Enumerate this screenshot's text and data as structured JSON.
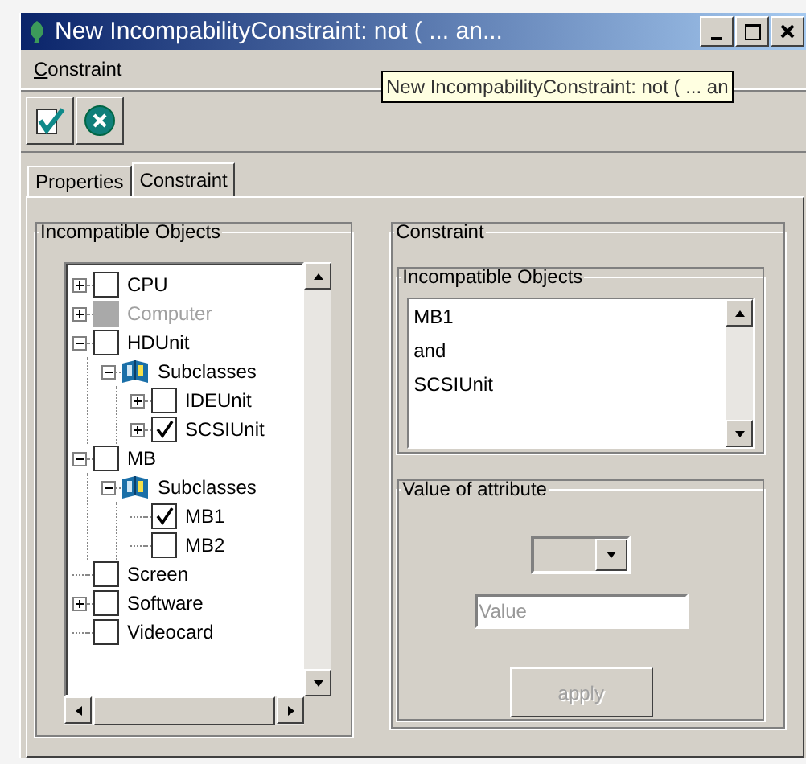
{
  "window": {
    "title": "New IncompabilityConstraint: not ( ... an..."
  },
  "menu": [
    {
      "label": "Constraint",
      "mnemonic_underlined": true
    }
  ],
  "tooltip": "New IncompabilityConstraint: not ( ... an",
  "toolbar": [
    {
      "kind": "ok"
    },
    {
      "kind": "cancel"
    }
  ],
  "tabs": [
    {
      "label": "Properties",
      "selected": false
    },
    {
      "label": "Constraint",
      "selected": true
    }
  ],
  "objects_group": {
    "title": "Incompatible Objects",
    "tree": [
      {
        "label": "CPU",
        "kind": "checkbox",
        "expandable": true,
        "expanded": false,
        "checked": false,
        "disabled": false
      },
      {
        "label": "Computer",
        "kind": "checkbox",
        "expandable": true,
        "expanded": false,
        "checked": false,
        "disabled": true
      },
      {
        "label": "HDUnit",
        "kind": "checkbox",
        "expandable": true,
        "expanded": true,
        "checked": false,
        "disabled": false,
        "children": [
          {
            "label": "Subclasses",
            "kind": "folder",
            "expandable": true,
            "expanded": true,
            "children": [
              {
                "label": "IDEUnit",
                "kind": "checkbox",
                "expandable": true,
                "expanded": false,
                "checked": false,
                "disabled": false
              },
              {
                "label": "SCSIUnit",
                "kind": "checkbox",
                "expandable": true,
                "expanded": false,
                "checked": true,
                "disabled": false
              }
            ]
          }
        ]
      },
      {
        "label": "MB",
        "kind": "checkbox",
        "expandable": true,
        "expanded": true,
        "checked": false,
        "disabled": false,
        "children": [
          {
            "label": "Subclasses",
            "kind": "folder",
            "expandable": true,
            "expanded": true,
            "children": [
              {
                "label": "MB1",
                "kind": "checkbox",
                "expandable": false,
                "checked": true,
                "disabled": false
              },
              {
                "label": "MB2",
                "kind": "checkbox",
                "expandable": false,
                "checked": false,
                "disabled": false
              }
            ]
          }
        ]
      },
      {
        "label": "Screen",
        "kind": "checkbox",
        "expandable": false,
        "checked": false,
        "disabled": false
      },
      {
        "label": "Software",
        "kind": "checkbox",
        "expandable": true,
        "expanded": false,
        "checked": false,
        "disabled": false
      },
      {
        "label": "Videocard",
        "kind": "checkbox",
        "expandable": false,
        "checked": false,
        "disabled": false
      }
    ]
  },
  "constraint_group": {
    "title": "Constraint",
    "objects": {
      "title": "Incompatible Objects",
      "items": [
        "MB1",
        "and",
        "SCSIUnit"
      ]
    },
    "value_group": {
      "title": "Value of attribute",
      "value_placeholder": "Value",
      "apply_button": {
        "label": "apply",
        "disabled": true
      }
    }
  }
}
